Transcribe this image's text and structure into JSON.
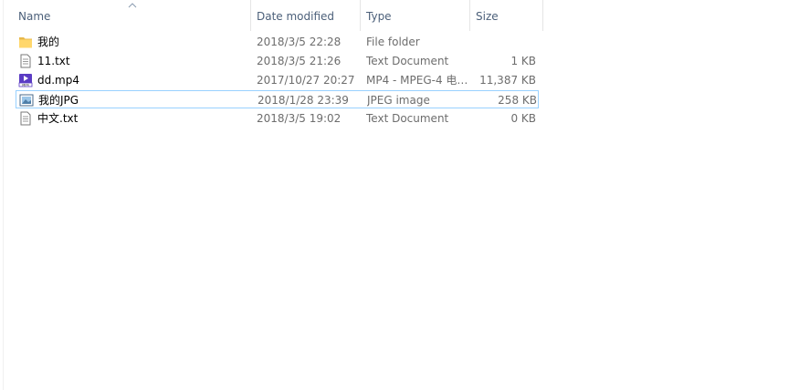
{
  "columns": {
    "name": "Name",
    "date_modified": "Date modified",
    "type": "Type",
    "size": "Size"
  },
  "files": [
    {
      "name": "我的",
      "date": "2018/3/5 22:28",
      "type": "File folder",
      "size": "",
      "icon": "folder-icon"
    },
    {
      "name": "11.txt",
      "date": "2018/3/5 21:26",
      "type": "Text Document",
      "size": "1 KB",
      "icon": "text-document-icon"
    },
    {
      "name": "dd.mp4",
      "date": "2017/10/27 20:27",
      "type": "MP4 - MPEG-4 电…",
      "size": "11,387 KB",
      "icon": "video-file-icon"
    },
    {
      "name": "我的JPG",
      "date": "2018/1/28 23:39",
      "type": "JPEG image",
      "size": "258 KB",
      "icon": "image-file-icon"
    },
    {
      "name": "中文.txt",
      "date": "2018/3/5 19:02",
      "type": "Text Document",
      "size": "0 KB",
      "icon": "text-document-icon"
    }
  ],
  "selected_index": 3,
  "sort": {
    "column": "name",
    "direction": "ascending"
  },
  "colors": {
    "header_text": "#4c607a",
    "selection_border": "#99d1ff",
    "folder": "#ffd76c",
    "video_icon": "#5b3cc4"
  }
}
